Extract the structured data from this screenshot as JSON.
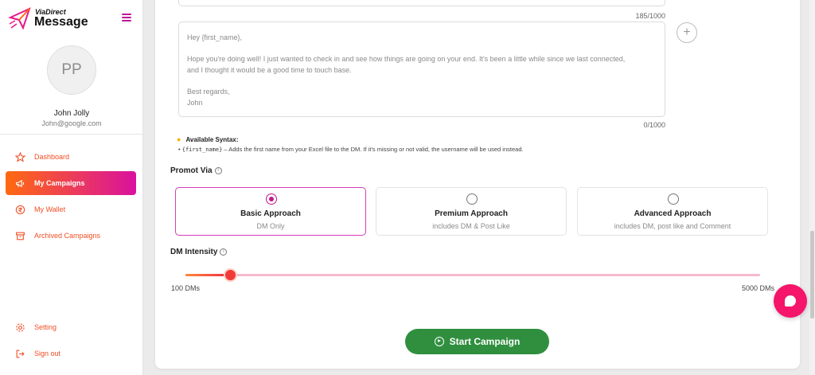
{
  "app": {
    "brand_small": "ViaDirect",
    "brand_big": "Message",
    "accent_gradient": [
      "#ff6a10",
      "#d9119e"
    ]
  },
  "user": {
    "initials": "PP",
    "name": "John Jolly",
    "email": "John@google.com"
  },
  "sidebar": {
    "items": [
      {
        "label": "Dashboard",
        "icon": "star-icon"
      },
      {
        "label": "My Campaigns",
        "icon": "megaphone-icon",
        "active": true
      },
      {
        "label": "My Wallet",
        "icon": "rupee-icon"
      },
      {
        "label": "Archived Campaigns",
        "icon": "archive-icon"
      }
    ],
    "bottom_items": [
      {
        "label": "Setting",
        "icon": "gear-icon"
      },
      {
        "label": "Sign out",
        "icon": "sign-out-icon"
      }
    ]
  },
  "messages": {
    "prev_count": "185/1000",
    "main_lines": [
      "Hey {first_name},",
      "Hope you're doing well! I just wanted to check in and see how things are going on your end. It's been a little while since we last connected,",
      "and I thought it would be a good time to touch base.",
      "Best regards,",
      "John"
    ],
    "main_count": "0/1000",
    "add_label": "+"
  },
  "syntax": {
    "title": "Available Syntax:",
    "bullet": "•",
    "token": "{first_name}",
    "description": " – Adds the first name from your Excel file to the DM. If it's missing or not valid, the username will be used instead."
  },
  "promote": {
    "label": "Promot Via",
    "options": [
      {
        "title": "Basic Approach",
        "subtitle": "DM Only",
        "selected": true
      },
      {
        "title": "Premium Approach",
        "subtitle": "includes DM & Post Like",
        "selected": false
      },
      {
        "title": "Advanced Approach",
        "subtitle": "includes DM, post like and Comment",
        "selected": false
      }
    ]
  },
  "intensity": {
    "label": "DM Intensity",
    "min_label": "100 DMs",
    "max_label": "5000 DMs",
    "min": 100,
    "max": 5000,
    "value": 480
  },
  "actions": {
    "start_label": "Start Campaign",
    "start_color": "#2f8f3e"
  },
  "chat": {
    "fab_color": "#f5156b"
  }
}
